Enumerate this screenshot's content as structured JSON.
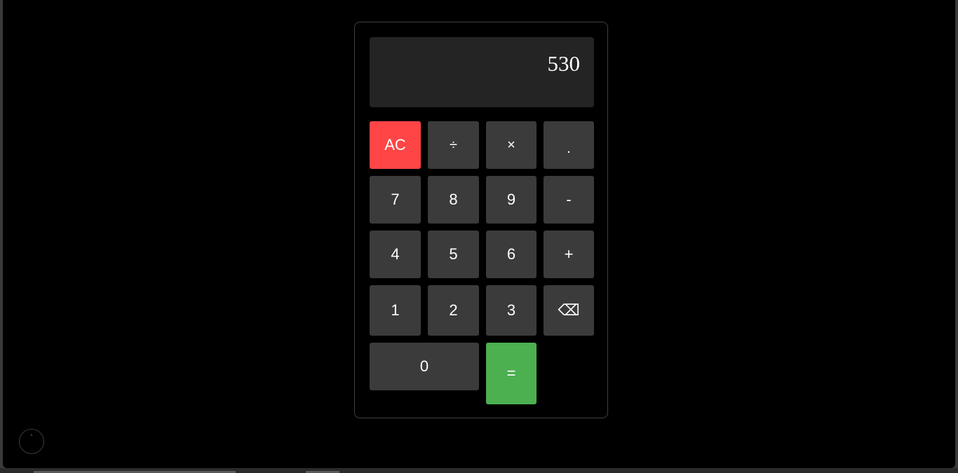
{
  "display": {
    "value": "530"
  },
  "keys": {
    "clear": "AC",
    "divide": "÷",
    "multiply": "×",
    "decimal": ".",
    "seven": "7",
    "eight": "8",
    "nine": "9",
    "subtract": "-",
    "four": "4",
    "five": "5",
    "six": "6",
    "add": "+",
    "one": "1",
    "two": "2",
    "three": "3",
    "backspace": "⌫",
    "zero": "0",
    "equals": "="
  },
  "corner_button": {
    "label": "`"
  },
  "colors": {
    "background": "#000000",
    "display_bg": "#242424",
    "key_bg": "#3c3b3c",
    "clear_bg": "#ff4545",
    "equals_bg": "#4caf50",
    "text": "#ffffff"
  }
}
